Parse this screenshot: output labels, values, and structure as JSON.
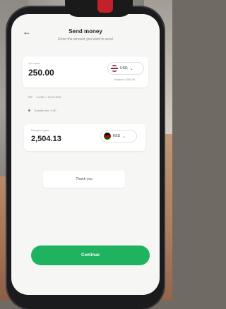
{
  "header": {
    "title": "Send money",
    "subtitle": "Enter the amount you want to send"
  },
  "you_send": {
    "label": "You send",
    "amount": "250.00",
    "currency": "USD",
    "balance": "Balance: $86.08"
  },
  "info": {
    "rate": "1 USD = 10.02 KES",
    "fee": "Transfer fee: 0.50"
  },
  "recipient_gets": {
    "label": "Recipient gets",
    "amount": "2,504.13",
    "currency": "KES"
  },
  "thank_you_label": "Thank you",
  "continue_label": "Continue",
  "colors": {
    "accent": "#1fb25f",
    "screen_bg": "#f6f6f4",
    "card_bg": "#ffffff"
  }
}
